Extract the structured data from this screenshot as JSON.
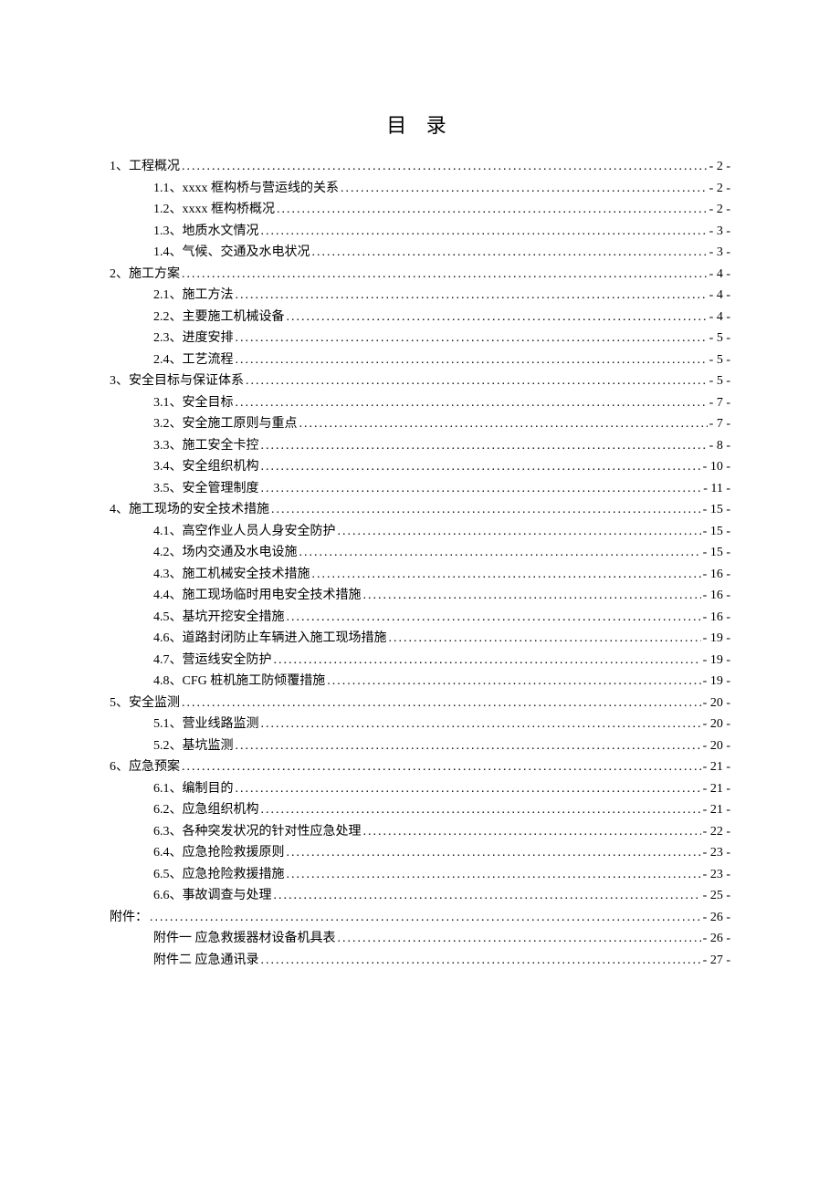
{
  "title": "目 录",
  "toc": [
    {
      "level": 1,
      "label": "1、工程概况",
      "page": "- 2 -"
    },
    {
      "level": 2,
      "label": "1.1、xxxx 框构桥与营运线的关系",
      "page": "- 2 -"
    },
    {
      "level": 2,
      "label": "1.2、xxxx 框构桥概况",
      "page": "- 2 -"
    },
    {
      "level": 2,
      "label": "1.3、地质水文情况",
      "page": "- 3 -"
    },
    {
      "level": 2,
      "label": "1.4、气候、交通及水电状况",
      "page": "- 3 -"
    },
    {
      "level": 1,
      "label": "2、施工方案",
      "page": "- 4 -"
    },
    {
      "level": 2,
      "label": "2.1、施工方法",
      "page": "- 4 -"
    },
    {
      "level": 2,
      "label": "2.2、主要施工机械设备",
      "page": "- 4 -"
    },
    {
      "level": 2,
      "label": "2.3、进度安排",
      "page": "- 5 -"
    },
    {
      "level": 2,
      "label": "2.4、工艺流程",
      "page": "- 5 -"
    },
    {
      "level": 1,
      "label": "3、安全目标与保证体系",
      "page": "- 5 -"
    },
    {
      "level": 2,
      "label": "3.1、安全目标",
      "page": "- 7 -"
    },
    {
      "level": 2,
      "label": "3.2、安全施工原则与重点",
      "page": "- 7 -"
    },
    {
      "level": 2,
      "label": "3.3、施工安全卡控",
      "page": "- 8 -"
    },
    {
      "level": 2,
      "label": "3.4、安全组织机构",
      "page": "- 10 -"
    },
    {
      "level": 2,
      "label": "3.5、安全管理制度",
      "page": "- 11 -"
    },
    {
      "level": 1,
      "label": "4、施工现场的安全技术措施",
      "page": "- 15 -"
    },
    {
      "level": 2,
      "label": "4.1、高空作业人员人身安全防护",
      "page": "- 15 -"
    },
    {
      "level": 2,
      "label": "4.2、场内交通及水电设施",
      "page": "- 15 -"
    },
    {
      "level": 2,
      "label": "4.3、施工机械安全技术措施",
      "page": "- 16 -"
    },
    {
      "level": 2,
      "label": "4.4、施工现场临时用电安全技术措施",
      "page": "- 16 -"
    },
    {
      "level": 2,
      "label": "4.5、基坑开挖安全措施",
      "page": "- 16 -"
    },
    {
      "level": 2,
      "label": "4.6、道路封闭防止车辆进入施工现场措施",
      "page": "- 19 -"
    },
    {
      "level": 2,
      "label": "4.7、营运线安全防护",
      "page": "- 19 -"
    },
    {
      "level": 2,
      "label": "4.8、CFG 桩机施工防倾覆措施",
      "page": "- 19 -"
    },
    {
      "level": 1,
      "label": "5、安全监测",
      "page": "- 20 -"
    },
    {
      "level": 2,
      "label": "5.1、营业线路监测",
      "page": "- 20 -"
    },
    {
      "level": 2,
      "label": "5.2、基坑监测",
      "page": "- 20 -"
    },
    {
      "level": 1,
      "label": "6、应急预案",
      "page": "- 21 -"
    },
    {
      "level": 2,
      "label": "6.1、编制目的",
      "page": "- 21 -"
    },
    {
      "level": 2,
      "label": "6.2、应急组织机构",
      "page": "- 21 -"
    },
    {
      "level": 2,
      "label": "6.3、各种突发状况的针对性应急处理",
      "page": "- 22 -"
    },
    {
      "level": 2,
      "label": "6.4、应急抢险救援原则",
      "page": "- 23 -"
    },
    {
      "level": 2,
      "label": "6.5、应急抢险救援措施",
      "page": "- 23 -"
    },
    {
      "level": 2,
      "label": "6.6、事故调查与处理",
      "page": "- 25 -"
    },
    {
      "level": 1,
      "label": "附件：",
      "page": "- 26 -"
    },
    {
      "level": 2,
      "label": "附件一 应急救援器材设备机具表",
      "page": "- 26 -"
    },
    {
      "level": 2,
      "label": "附件二 应急通讯录",
      "page": "- 27 -"
    }
  ]
}
